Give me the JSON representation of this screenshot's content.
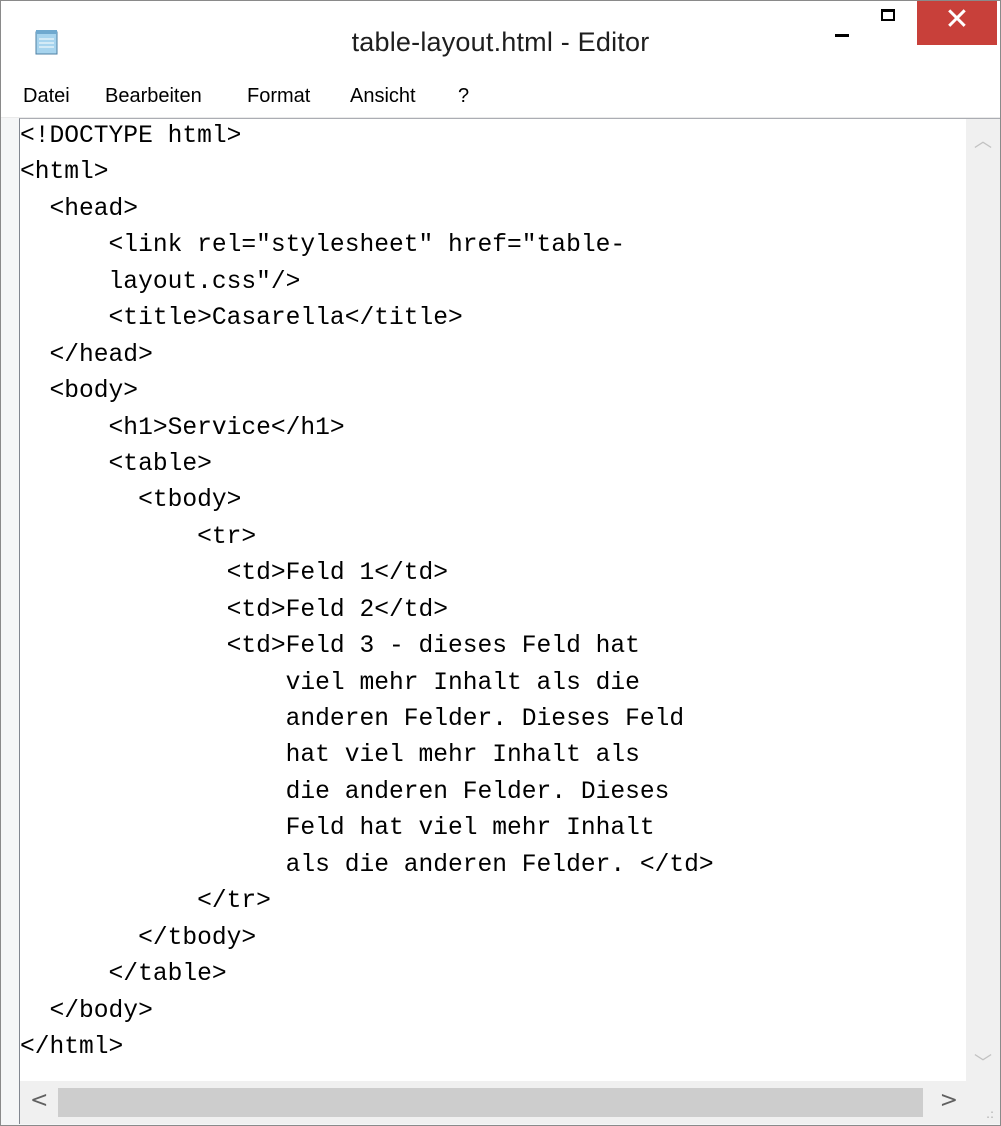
{
  "window": {
    "title": "table-layout.html - Editor",
    "minimize_icon": "minimize-icon",
    "maximize_icon": "maximize-icon",
    "close_icon": "close-icon",
    "close_glyph": "✕",
    "accent_close": "#c8403a",
    "app_icon": "notepad-icon"
  },
  "menu": {
    "items": [
      "Datei",
      "Bearbeiten",
      "Format",
      "Ansicht",
      "?"
    ]
  },
  "editor": {
    "lines": [
      "<!DOCTYPE html>",
      "<html>",
      "  <head>",
      "      <link rel=\"stylesheet\" href=\"table-",
      "      layout.css\"/>",
      "      <title>Casarella</title>",
      "  </head>",
      "  <body>",
      "      <h1>Service</h1>",
      "      <table>",
      "        <tbody>",
      "            <tr>",
      "              <td>Feld 1</td>",
      "              <td>Feld 2</td>",
      "              <td>Feld 3 - dieses Feld hat",
      "                  viel mehr Inhalt als die",
      "                  anderen Felder. Dieses Feld",
      "                  hat viel mehr Inhalt als",
      "                  die anderen Felder. Dieses",
      "                  Feld hat viel mehr Inhalt",
      "                  als die anderen Felder. </td>",
      "            </tr>",
      "        </tbody>",
      "      </table>",
      "  </body>",
      "</html>"
    ]
  },
  "scrollbars": {
    "up_glyph": "︿",
    "down_glyph": "﹀",
    "left_glyph": "<",
    "right_glyph": ">",
    "grip_glyph": ".:"
  }
}
